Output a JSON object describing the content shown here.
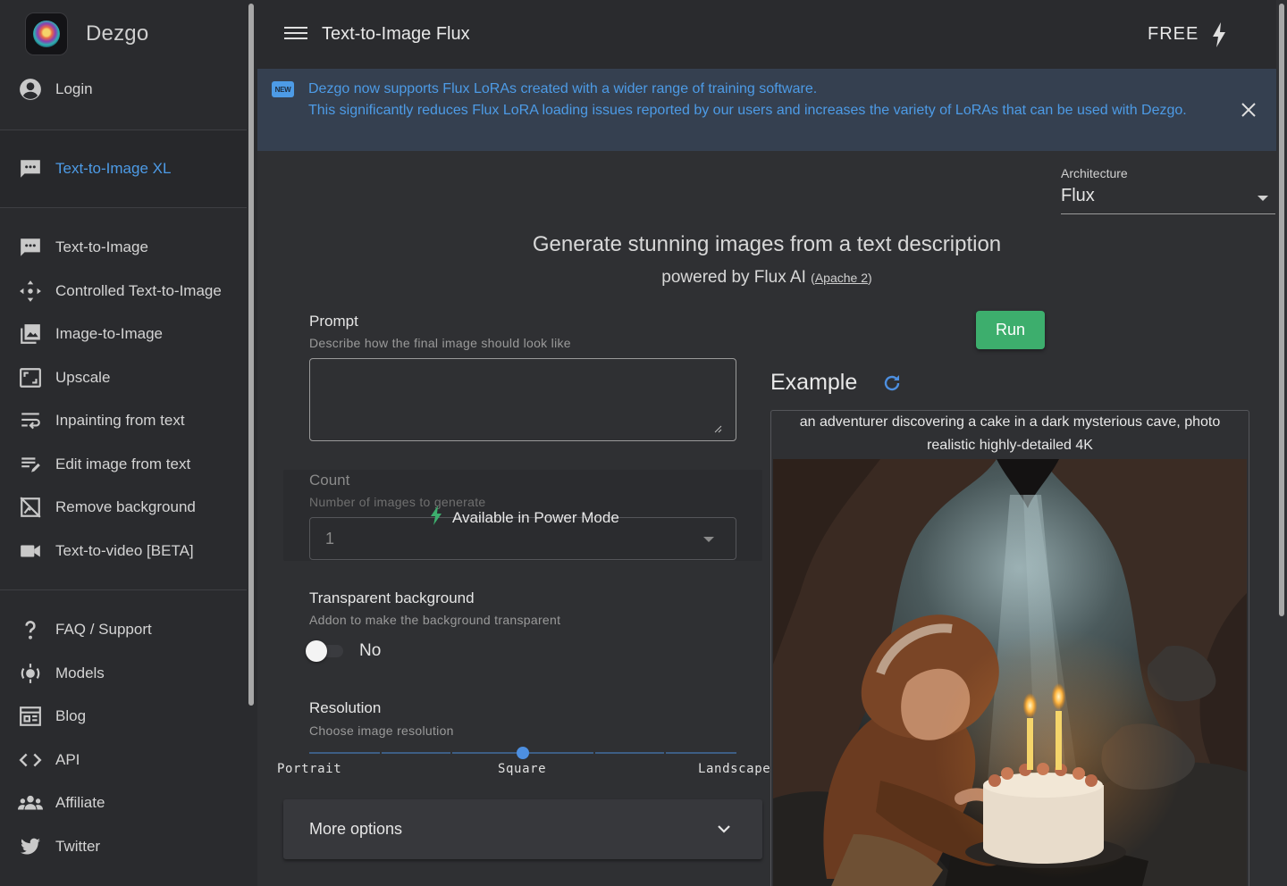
{
  "app": {
    "name": "Dezgo"
  },
  "sidebar": {
    "login": "Login",
    "active": {
      "label": "Text-to-Image XL",
      "icon": "chat-icon"
    },
    "tools": [
      {
        "label": "Text-to-Image",
        "icon": "chat-icon"
      },
      {
        "label": "Controlled Text-to-Image",
        "icon": "control-arrows-icon"
      },
      {
        "label": "Image-to-Image",
        "icon": "images-icon"
      },
      {
        "label": "Upscale",
        "icon": "upscale-icon"
      },
      {
        "label": "Inpainting from text",
        "icon": "wrap-text-icon"
      },
      {
        "label": "Edit image from text",
        "icon": "edit-text-icon"
      },
      {
        "label": "Remove background",
        "icon": "no-image-icon"
      },
      {
        "label": "Text-to-video [BETA]",
        "icon": "video-camera-icon"
      }
    ],
    "links": [
      {
        "label": "FAQ / Support",
        "icon": "question-icon"
      },
      {
        "label": "Models",
        "icon": "models-icon"
      },
      {
        "label": "Blog",
        "icon": "blog-icon"
      },
      {
        "label": "API",
        "icon": "code-icon"
      },
      {
        "label": "Affiliate",
        "icon": "group-icon"
      },
      {
        "label": "Twitter",
        "icon": "twitter-icon"
      }
    ]
  },
  "header": {
    "title": "Text-to-Image Flux",
    "plan": "FREE"
  },
  "banner": {
    "badge": "NEW",
    "line1": "Dezgo now supports Flux LoRAs created with a wider range of training software.",
    "line2": "This significantly reduces Flux LoRA loading issues reported by our users and increases the variety of LoRAs that can be used with Dezgo."
  },
  "architecture": {
    "label": "Architecture",
    "value": "Flux"
  },
  "hero": {
    "headline": "Generate stunning images from a text description",
    "powered_by": "powered by Flux AI",
    "license_open": "(",
    "license": "Apache 2",
    "license_close": ")"
  },
  "form": {
    "prompt": {
      "label": "Prompt",
      "help": "Describe how the final image should look like",
      "value": ""
    },
    "count": {
      "label": "Count",
      "help": "Number of images to generate",
      "value": "1",
      "locked_note": "Available in Power Mode"
    },
    "transparent": {
      "label": "Transparent background",
      "help": "Addon to make the background transparent",
      "state": "No"
    },
    "resolution": {
      "label": "Resolution",
      "help": "Choose image resolution",
      "marks": [
        "Portrait",
        "Square",
        "Landscape"
      ],
      "selected": "Square"
    },
    "more_options": "More options"
  },
  "run_label": "Run",
  "example": {
    "title": "Example",
    "caption": "an adventurer discovering a cake in a dark mysterious cave, photo realistic highly-detailed 4K"
  },
  "colors": {
    "accent": "#4d9be6",
    "run": "#3dae6d",
    "banner_bg": "#354050"
  }
}
